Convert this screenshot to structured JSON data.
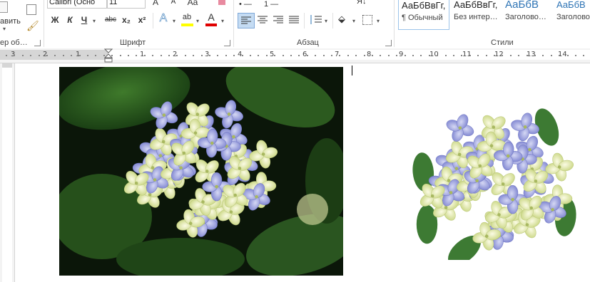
{
  "clipboard": {
    "paste_label": "авить",
    "painter_label": "ер об…"
  },
  "font": {
    "name": "Calibri (Осно",
    "size": "11",
    "bold": "Ж",
    "italic": "К",
    "underline": "Ч",
    "strike": "abc",
    "subscript": "x₂",
    "superscript": "x²",
    "effects": "A",
    "highlight": "ab",
    "color": "A",
    "group_label": "Шрифт"
  },
  "paragraph": {
    "group_label": "Абзац",
    "sort": "Я↓"
  },
  "styles": {
    "group_label": "Стили",
    "items": [
      {
        "sample": "АаБбВвГг,",
        "name": "¶ Обычный"
      },
      {
        "sample": "АаБбВвГг,",
        "name": "Без интер…"
      },
      {
        "sample": "АаБбВ",
        "name": "Заголово…"
      },
      {
        "sample": "АаБбВ",
        "name": "Заголово…"
      }
    ]
  },
  "ruler": {
    "labels": [
      "3",
      "2",
      "1",
      "1",
      "2",
      "3",
      "4",
      "5",
      "6",
      "7",
      "8",
      "9",
      "10",
      "11",
      "12",
      "13",
      "14"
    ]
  },
  "colors": {
    "accent": "#2b579a",
    "heading": "#2e74b5"
  }
}
